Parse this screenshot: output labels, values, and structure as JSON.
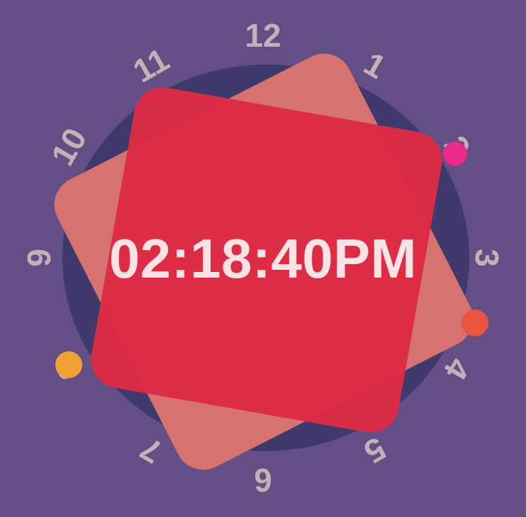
{
  "watchface": {
    "time_display": "02:18:40PM",
    "numerals": [
      "12",
      "1",
      "2",
      "3",
      "4",
      "5",
      "6",
      "7",
      "8",
      "9",
      "10",
      "11"
    ]
  },
  "colors": {
    "background": "#634F85",
    "dial": "#403A6C",
    "square_back": "#D6726F",
    "square_front": "#DD2A45",
    "time_text": "#FBE3E5",
    "numerals": "#BFB3B8",
    "dot_2": "#EC2A8C",
    "dot_4": "#E9553F",
    "dot_8": "#EFA233"
  },
  "icons": {
    "dot_2": "pink-complication-dot",
    "dot_4": "orange-red-complication-dot",
    "dot_8": "amber-complication-dot"
  }
}
